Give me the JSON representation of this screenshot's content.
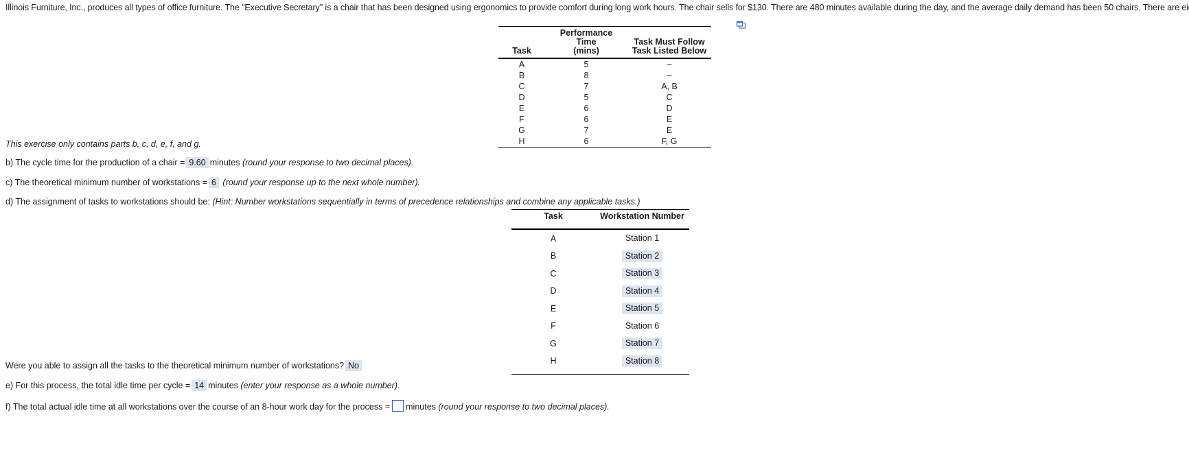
{
  "intro": "Illinois Furniture, Inc., produces all types of office furniture. The \"Executive Secretary\" is a chair that has been designed using ergonomics to provide comfort during long work hours. The chair sells for $130. There are 480 minutes available during the day, and the average daily demand has been 50 chairs. There are eight tasks:",
  "popout_icon": "popout-window-icon",
  "task_table": {
    "headers": [
      "Task",
      "Performance Time (mins)",
      "Task Must Follow Task Listed Below"
    ],
    "header_lines": {
      "task": "Task",
      "time_l1": "Performance Time",
      "time_l2": "(mins)",
      "prec_l1": "Task Must Follow",
      "prec_l2": "Task Listed Below"
    },
    "rows": [
      {
        "task": "A",
        "time": "5",
        "predecessor": "–"
      },
      {
        "task": "B",
        "time": "8",
        "predecessor": "–"
      },
      {
        "task": "C",
        "time": "7",
        "predecessor": "A, B"
      },
      {
        "task": "D",
        "time": "5",
        "predecessor": "C"
      },
      {
        "task": "E",
        "time": "6",
        "predecessor": "D"
      },
      {
        "task": "F",
        "time": "6",
        "predecessor": "E"
      },
      {
        "task": "G",
        "time": "7",
        "predecessor": "E"
      },
      {
        "task": "H",
        "time": "6",
        "predecessor": "F, G"
      }
    ]
  },
  "note": "This exercise only contains parts b, c, d, e, f, and g.",
  "part_b": {
    "prefix": "b) The cycle time for the production of a chair =",
    "answer": "9.60",
    "unit": "minutes",
    "hint": "(round your response to two decimal places)."
  },
  "part_c": {
    "prefix": "c) The theoretical minimum number of workstations =",
    "answer": "6",
    "hint": "(round your response up to the next whole number)."
  },
  "part_d": {
    "prefix": "d) The assignment of tasks to workstations should be:",
    "hint": "(Hint: Number workstations sequentially in terms of precedence relationships and combine any applicable tasks.)"
  },
  "station_table": {
    "headers": [
      "Task",
      "Workstation Number"
    ],
    "rows": [
      {
        "task": "A",
        "station": "Station 1",
        "highlighted": false
      },
      {
        "task": "B",
        "station": "Station 2",
        "highlighted": true
      },
      {
        "task": "C",
        "station": "Station 3",
        "highlighted": true
      },
      {
        "task": "D",
        "station": "Station 4",
        "highlighted": true
      },
      {
        "task": "E",
        "station": "Station 5",
        "highlighted": true
      },
      {
        "task": "F",
        "station": "Station 6",
        "highlighted": false
      },
      {
        "task": "G",
        "station": "Station 7",
        "highlighted": true
      },
      {
        "task": "H",
        "station": "Station 8",
        "highlighted": true
      }
    ]
  },
  "assign_question": {
    "prefix": "Were you able to assign all the tasks to the theoretical minimum number of workstations?",
    "answer": "No"
  },
  "part_e": {
    "prefix": "e) For this process, the total idle time per cycle =",
    "answer": "14",
    "unit": "minutes",
    "hint": "(enter your response as a whole number)."
  },
  "part_f": {
    "prefix": "f) The total actual idle time at all workstations over the course of an 8-hour work day for the process =",
    "answer": "",
    "unit": "minutes",
    "hint": "(round your response to two decimal places)."
  },
  "colors": {
    "answer_fill": "#dde5f1",
    "input_border": "#2f5bbb",
    "text": "#1b1b1b"
  }
}
